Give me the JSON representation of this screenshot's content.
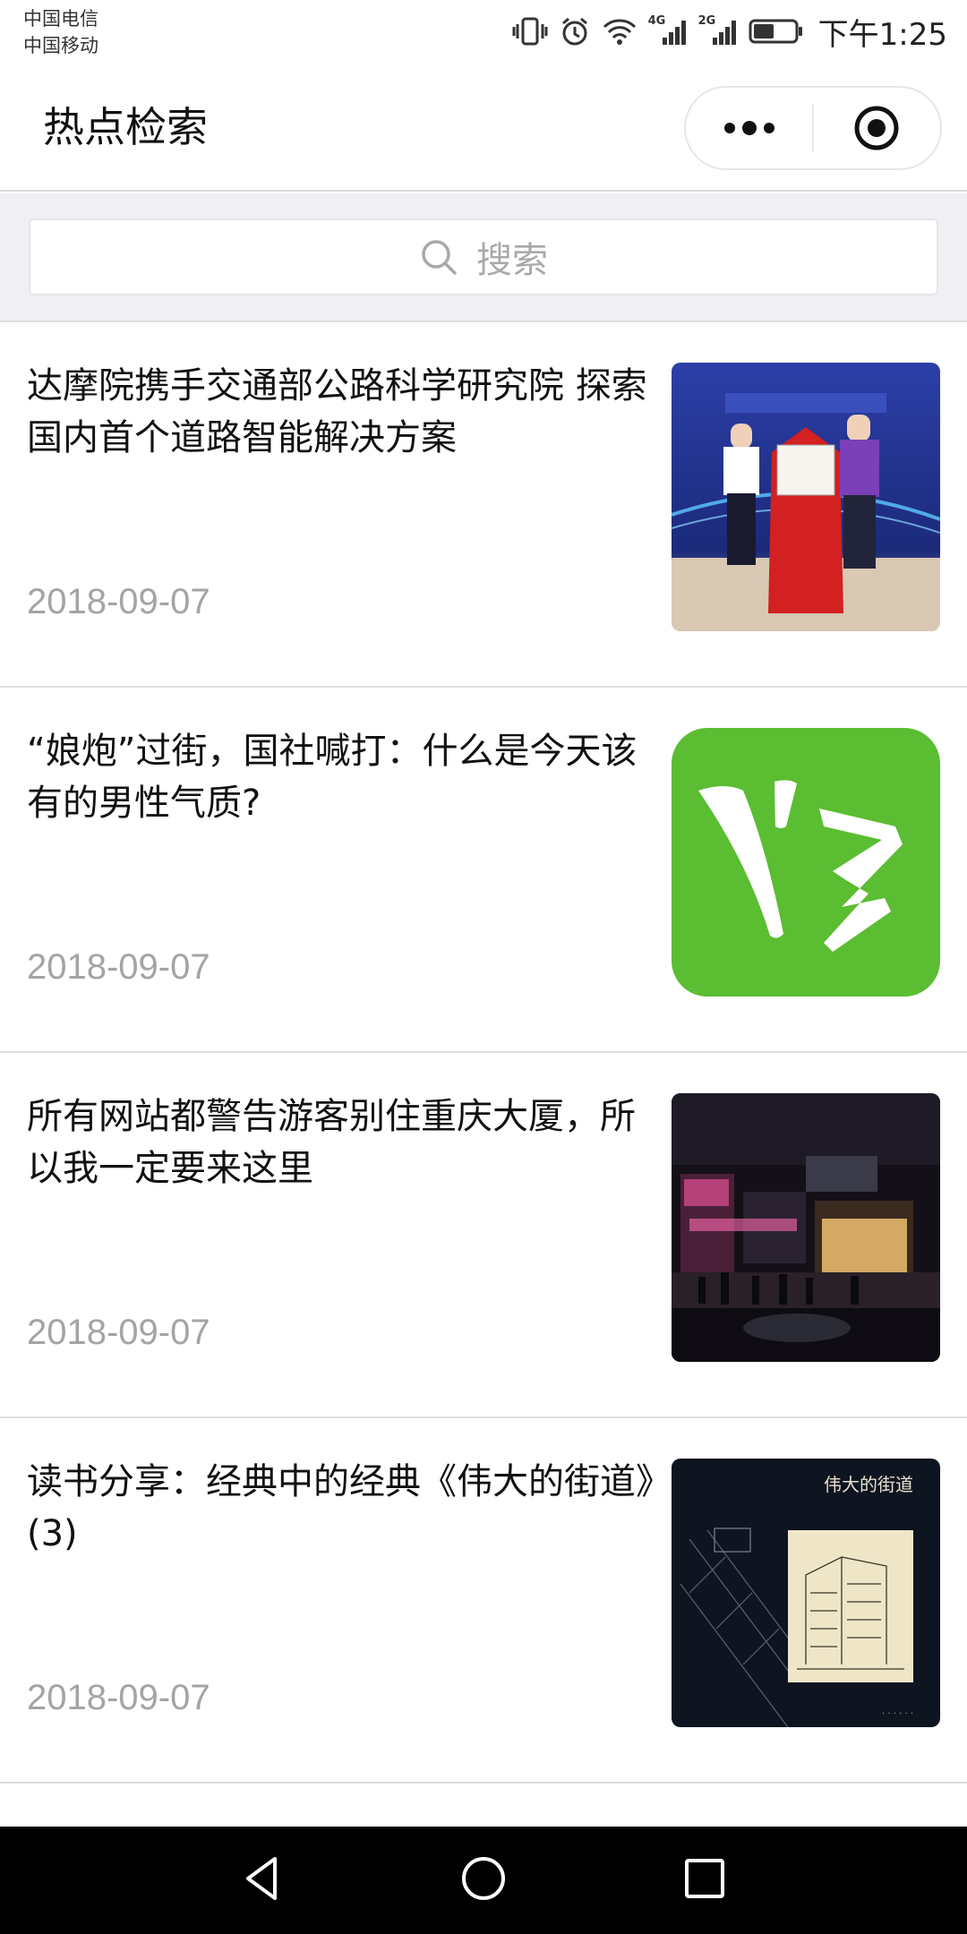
{
  "status_bar": {
    "carriers": [
      "中国电信",
      "中国移动"
    ],
    "network_1": "4G",
    "network_2": "2G",
    "time": "下午1:25"
  },
  "nav": {
    "title": "热点检索"
  },
  "search": {
    "placeholder": "搜索"
  },
  "news": [
    {
      "title": "达摩院携手交通部公路科学研究院 探索国内首个道路智能解决方案",
      "date": "2018-09-07",
      "thumb": "signing-ceremony-photo"
    },
    {
      "title": "“娘炮”过街，国社喊打：什么是今天该有的男性气质?",
      "date": "2018-09-07",
      "thumb": "green-app-logo"
    },
    {
      "title": "所有网站都警告游客别住重庆大厦，所以我一定要来这里",
      "date": "2018-09-07",
      "thumb": "night-street-photo"
    },
    {
      "title": "读书分享：经典中的经典《伟大的街道》(3)",
      "date": "2018-09-07",
      "thumb": "book-cover",
      "thumb_text": "伟大的街道"
    }
  ]
}
